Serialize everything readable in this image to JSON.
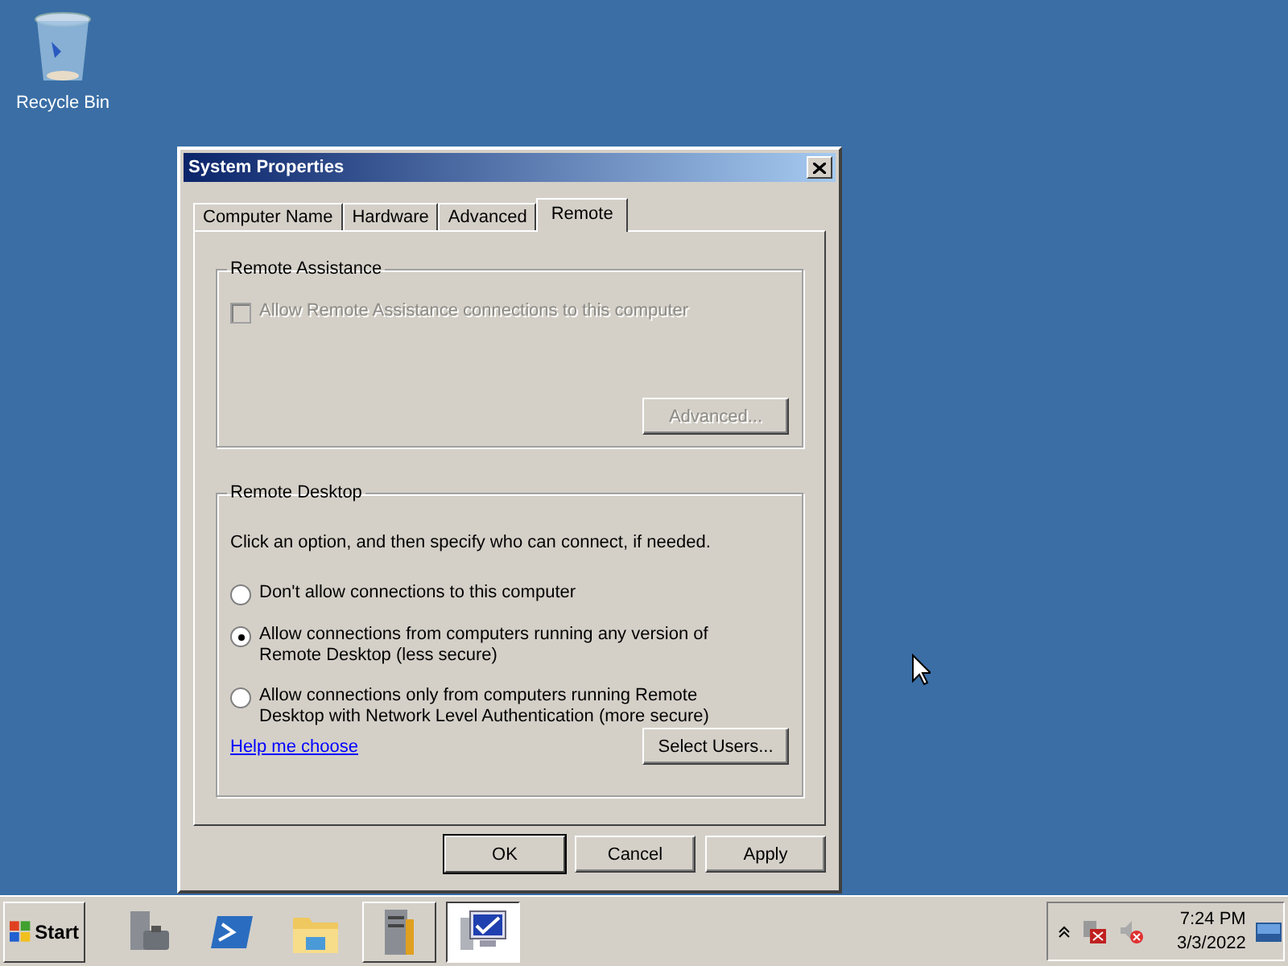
{
  "desktop_icons": [
    {
      "label": "Recycle Bin"
    }
  ],
  "window": {
    "title": "System Properties",
    "tabs": [
      {
        "label": "Computer Name",
        "selected": false
      },
      {
        "label": "Hardware",
        "selected": false
      },
      {
        "label": "Advanced",
        "selected": false
      },
      {
        "label": "Remote",
        "selected": true
      }
    ],
    "remote_assistance": {
      "title": "Remote Assistance",
      "checkbox": {
        "label": "Allow Remote Assistance connections to this computer",
        "checked": false,
        "disabled": true
      },
      "advanced_button": {
        "label": "Advanced...",
        "disabled": true
      }
    },
    "remote_desktop": {
      "title": "Remote Desktop",
      "instruction": "Click an option, and then specify who can connect, if needed.",
      "options": [
        {
          "lines": [
            "Don't allow connections to this computer"
          ],
          "selected": false
        },
        {
          "lines": [
            "Allow connections from computers running any version of",
            "Remote Desktop (less secure)"
          ],
          "selected": true
        },
        {
          "lines": [
            "Allow connections only from computers running Remote",
            "Desktop with Network Level Authentication (more secure)"
          ],
          "selected": false
        }
      ],
      "help_link": "Help me choose",
      "select_users_button": "Select Users..."
    },
    "buttons": [
      {
        "label": "OK",
        "default": true
      },
      {
        "label": "Cancel",
        "default": false
      },
      {
        "label": "Apply",
        "default": false
      }
    ]
  },
  "taskbar": {
    "start": "Start",
    "apps": [
      {
        "kind": "server",
        "open": false,
        "selected": false
      },
      {
        "kind": "shell",
        "open": false,
        "selected": false
      },
      {
        "kind": "folder",
        "open": false,
        "selected": false
      },
      {
        "kind": "tools",
        "open": true,
        "selected": false
      },
      {
        "kind": "system",
        "open": true,
        "selected": true
      }
    ],
    "tray": {
      "time": "7:24 PM",
      "date": "3/3/2022"
    }
  }
}
